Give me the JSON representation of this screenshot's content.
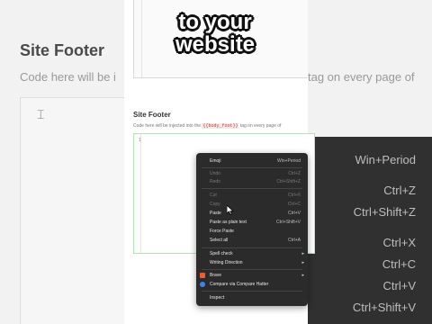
{
  "overlay": {
    "line1": "to your",
    "line2": "website"
  },
  "background": {
    "title": "Site Footer",
    "desc_left": "Code here will be i",
    "desc_right": "tag on every page of",
    "shortcuts": [
      "Win+Period",
      "Ctrl+Z",
      "Ctrl+Shift+Z",
      "Ctrl+X",
      "Ctrl+C",
      "Ctrl+V",
      "Ctrl+Shift+V"
    ]
  },
  "section": {
    "title": "Site Footer",
    "desc_before": "Code here will be injected into the",
    "desc_code": "{{body_foot}}",
    "desc_after": "tag on every page of"
  },
  "editor": {
    "line_number": "1"
  },
  "context_menu": {
    "items": [
      {
        "label": "Emoji",
        "shortcut": "Win+Period",
        "disabled": false
      },
      {
        "label": "Undo",
        "shortcut": "Ctrl+Z",
        "disabled": true
      },
      {
        "label": "Redo",
        "shortcut": "Ctrl+Shift+Z",
        "disabled": true
      },
      {
        "label": "Cut",
        "shortcut": "Ctrl+X",
        "disabled": true
      },
      {
        "label": "Copy",
        "shortcut": "Ctrl+C",
        "disabled": true
      },
      {
        "label": "Paste",
        "shortcut": "Ctrl+V",
        "disabled": false
      },
      {
        "label": "Paste as plain text",
        "shortcut": "Ctrl+Shift+V",
        "disabled": false
      },
      {
        "label": "Force Paste",
        "shortcut": "",
        "disabled": false
      },
      {
        "label": "Select all",
        "shortcut": "Ctrl+A",
        "disabled": false
      },
      {
        "label": "Spell check",
        "shortcut": "",
        "disabled": false
      },
      {
        "label": "Writing Direction",
        "shortcut": "",
        "disabled": false
      },
      {
        "label": "Brave",
        "shortcut": "",
        "disabled": false
      },
      {
        "label": "Compare via Compare Hatter",
        "shortcut": "",
        "disabled": false
      },
      {
        "label": "Inspect",
        "shortcut": "",
        "disabled": false
      }
    ]
  },
  "colors": {
    "menu_bg": "#2b2b2b",
    "brave_icon": "#f25c2a",
    "compare_icon": "#3b82f6",
    "code_red": "#c0392b",
    "editor_border": "#b9dfb9"
  }
}
